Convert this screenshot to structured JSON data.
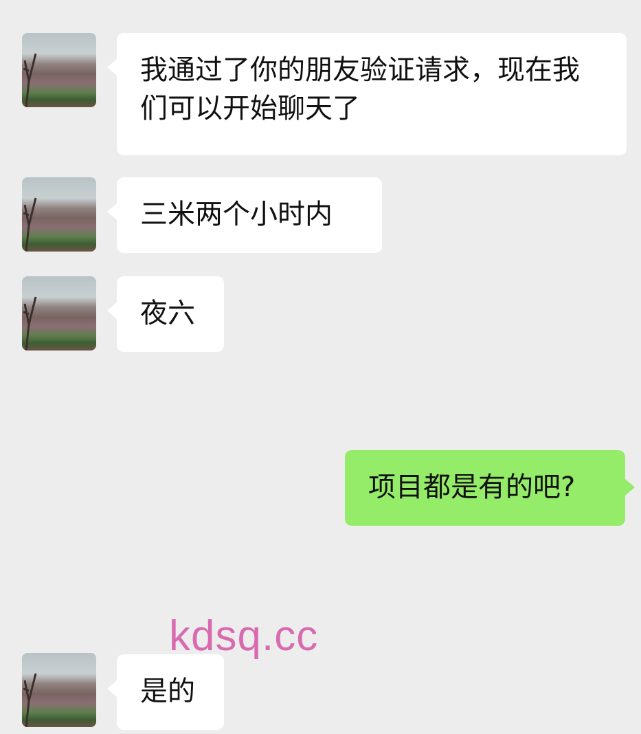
{
  "messages": [
    {
      "sender": "contact",
      "text": "我通过了你的朋友验证请求，现在我们可以开始聊天了"
    },
    {
      "sender": "contact",
      "text": "三米两个小时内"
    },
    {
      "sender": "contact",
      "text": "夜六"
    },
    {
      "sender": "me",
      "text": "项目都是有的吧?"
    },
    {
      "sender": "contact",
      "text": "是的"
    }
  ],
  "watermark": "kdsq.cc",
  "colors": {
    "background": "#ededed",
    "incoming_bubble": "#ffffff",
    "outgoing_bubble": "#95ec69",
    "watermark": "#d86bb0"
  }
}
